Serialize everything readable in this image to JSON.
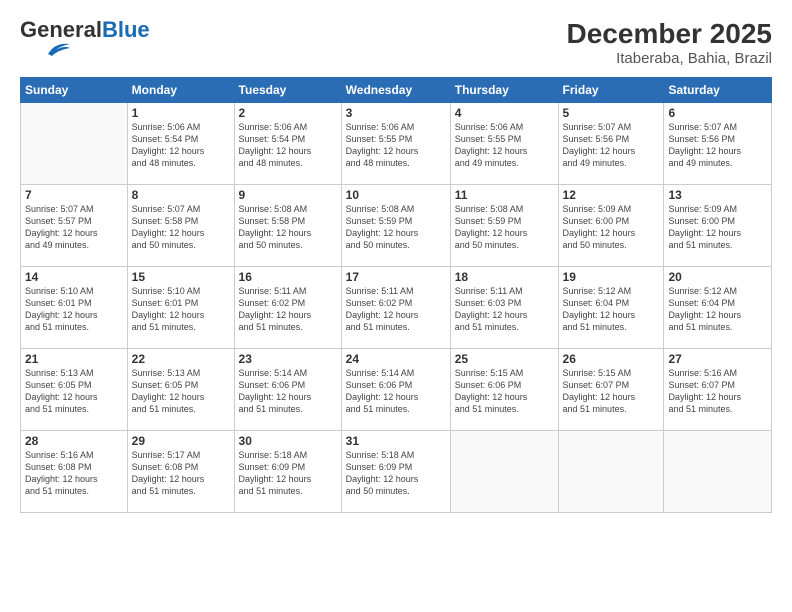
{
  "header": {
    "logo_general": "General",
    "logo_blue": "Blue",
    "title": "December 2025",
    "subtitle": "Itaberaba, Bahia, Brazil"
  },
  "weekdays": [
    "Sunday",
    "Monday",
    "Tuesday",
    "Wednesday",
    "Thursday",
    "Friday",
    "Saturday"
  ],
  "weeks": [
    [
      {
        "day": "",
        "text": ""
      },
      {
        "day": "1",
        "text": "Sunrise: 5:06 AM\nSunset: 5:54 PM\nDaylight: 12 hours\nand 48 minutes."
      },
      {
        "day": "2",
        "text": "Sunrise: 5:06 AM\nSunset: 5:54 PM\nDaylight: 12 hours\nand 48 minutes."
      },
      {
        "day": "3",
        "text": "Sunrise: 5:06 AM\nSunset: 5:55 PM\nDaylight: 12 hours\nand 48 minutes."
      },
      {
        "day": "4",
        "text": "Sunrise: 5:06 AM\nSunset: 5:55 PM\nDaylight: 12 hours\nand 49 minutes."
      },
      {
        "day": "5",
        "text": "Sunrise: 5:07 AM\nSunset: 5:56 PM\nDaylight: 12 hours\nand 49 minutes."
      },
      {
        "day": "6",
        "text": "Sunrise: 5:07 AM\nSunset: 5:56 PM\nDaylight: 12 hours\nand 49 minutes."
      }
    ],
    [
      {
        "day": "7",
        "text": "Sunrise: 5:07 AM\nSunset: 5:57 PM\nDaylight: 12 hours\nand 49 minutes."
      },
      {
        "day": "8",
        "text": "Sunrise: 5:07 AM\nSunset: 5:58 PM\nDaylight: 12 hours\nand 50 minutes."
      },
      {
        "day": "9",
        "text": "Sunrise: 5:08 AM\nSunset: 5:58 PM\nDaylight: 12 hours\nand 50 minutes."
      },
      {
        "day": "10",
        "text": "Sunrise: 5:08 AM\nSunset: 5:59 PM\nDaylight: 12 hours\nand 50 minutes."
      },
      {
        "day": "11",
        "text": "Sunrise: 5:08 AM\nSunset: 5:59 PM\nDaylight: 12 hours\nand 50 minutes."
      },
      {
        "day": "12",
        "text": "Sunrise: 5:09 AM\nSunset: 6:00 PM\nDaylight: 12 hours\nand 50 minutes."
      },
      {
        "day": "13",
        "text": "Sunrise: 5:09 AM\nSunset: 6:00 PM\nDaylight: 12 hours\nand 51 minutes."
      }
    ],
    [
      {
        "day": "14",
        "text": "Sunrise: 5:10 AM\nSunset: 6:01 PM\nDaylight: 12 hours\nand 51 minutes."
      },
      {
        "day": "15",
        "text": "Sunrise: 5:10 AM\nSunset: 6:01 PM\nDaylight: 12 hours\nand 51 minutes."
      },
      {
        "day": "16",
        "text": "Sunrise: 5:11 AM\nSunset: 6:02 PM\nDaylight: 12 hours\nand 51 minutes."
      },
      {
        "day": "17",
        "text": "Sunrise: 5:11 AM\nSunset: 6:02 PM\nDaylight: 12 hours\nand 51 minutes."
      },
      {
        "day": "18",
        "text": "Sunrise: 5:11 AM\nSunset: 6:03 PM\nDaylight: 12 hours\nand 51 minutes."
      },
      {
        "day": "19",
        "text": "Sunrise: 5:12 AM\nSunset: 6:04 PM\nDaylight: 12 hours\nand 51 minutes."
      },
      {
        "day": "20",
        "text": "Sunrise: 5:12 AM\nSunset: 6:04 PM\nDaylight: 12 hours\nand 51 minutes."
      }
    ],
    [
      {
        "day": "21",
        "text": "Sunrise: 5:13 AM\nSunset: 6:05 PM\nDaylight: 12 hours\nand 51 minutes."
      },
      {
        "day": "22",
        "text": "Sunrise: 5:13 AM\nSunset: 6:05 PM\nDaylight: 12 hours\nand 51 minutes."
      },
      {
        "day": "23",
        "text": "Sunrise: 5:14 AM\nSunset: 6:06 PM\nDaylight: 12 hours\nand 51 minutes."
      },
      {
        "day": "24",
        "text": "Sunrise: 5:14 AM\nSunset: 6:06 PM\nDaylight: 12 hours\nand 51 minutes."
      },
      {
        "day": "25",
        "text": "Sunrise: 5:15 AM\nSunset: 6:06 PM\nDaylight: 12 hours\nand 51 minutes."
      },
      {
        "day": "26",
        "text": "Sunrise: 5:15 AM\nSunset: 6:07 PM\nDaylight: 12 hours\nand 51 minutes."
      },
      {
        "day": "27",
        "text": "Sunrise: 5:16 AM\nSunset: 6:07 PM\nDaylight: 12 hours\nand 51 minutes."
      }
    ],
    [
      {
        "day": "28",
        "text": "Sunrise: 5:16 AM\nSunset: 6:08 PM\nDaylight: 12 hours\nand 51 minutes."
      },
      {
        "day": "29",
        "text": "Sunrise: 5:17 AM\nSunset: 6:08 PM\nDaylight: 12 hours\nand 51 minutes."
      },
      {
        "day": "30",
        "text": "Sunrise: 5:18 AM\nSunset: 6:09 PM\nDaylight: 12 hours\nand 51 minutes."
      },
      {
        "day": "31",
        "text": "Sunrise: 5:18 AM\nSunset: 6:09 PM\nDaylight: 12 hours\nand 50 minutes."
      },
      {
        "day": "",
        "text": ""
      },
      {
        "day": "",
        "text": ""
      },
      {
        "day": "",
        "text": ""
      }
    ]
  ]
}
